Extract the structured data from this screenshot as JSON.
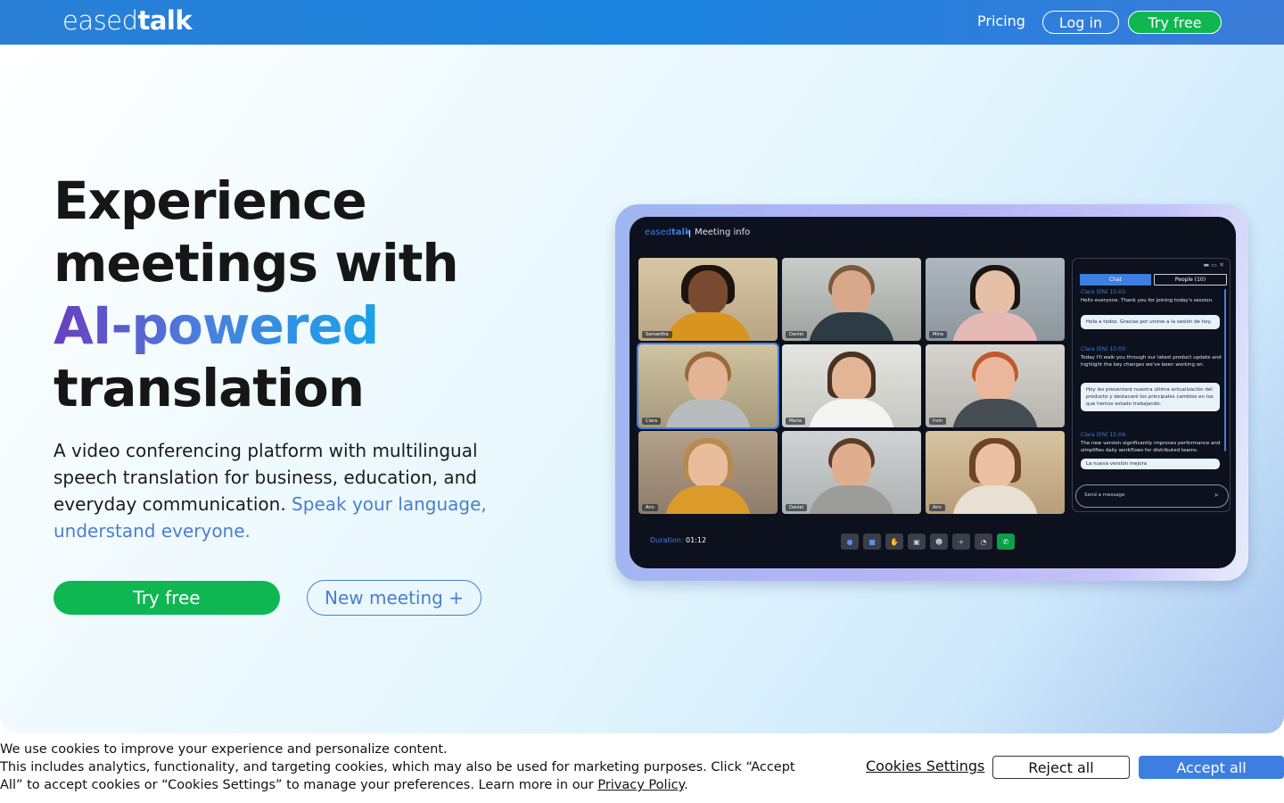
{
  "header": {
    "logo_part1": "eased",
    "logo_part2": "talk",
    "nav_pricing": "Pricing",
    "nav_login": "Log in",
    "nav_try": "Try free"
  },
  "hero": {
    "headline_line1": "Experience",
    "headline_line2": "meetings with",
    "headline_accent": "AI-powered",
    "headline_line4": "translation",
    "subtext": "A video conferencing platform with multilingual speech translation for business, education, and everyday communication.",
    "subtext_highlight": "Speak your language, understand everyone.",
    "btn_try": "Try free",
    "btn_new_meeting": "New meeting +"
  },
  "mockup": {
    "logo_part1": "eased",
    "logo_part2": "talk",
    "title": "Meeting info",
    "participants": [
      "Samantha",
      "Daniel",
      "Mina",
      "Clara",
      "Maria",
      "Irvin",
      "Ann",
      "Daniel",
      "Ann"
    ],
    "chat": {
      "window_controls": "▬ ▭ ✕",
      "tab_chat": "Chat",
      "tab_people": "People (10)",
      "messages": [
        {
          "header": "Clara (EN) 15:03:",
          "text": "Hello everyone. Thank you for joining today's session.",
          "translation": "Hola a todos. Gracias por unirse a la sesión de hoy."
        },
        {
          "header": "Clara (EN) 15:03:",
          "text": "Today I'll walk you through our latest product update and highlight the key changes we've been working on.",
          "translation": "Hoy les presentaré nuestra última actualización del producto y destacaré los principales cambios en los que hemos estado trabajando."
        },
        {
          "header": "Clara (EN) 15:04:",
          "text": "The new version significantly improves performance and simplifies daily workflows for distributed teams.",
          "translation": "La nueva versión mejora"
        }
      ],
      "input_placeholder": "Send a message"
    },
    "duration_label": "Duration:",
    "duration_value": "01:12"
  },
  "cookie": {
    "line1": "We use cookies to improve your experience and personalize content.",
    "line2": "This includes analytics, functionality, and targeting cookies, which may also be used for marketing purposes. Click “Accept All” to accept cookies or “Cookies Settings” to manage your preferences. Learn more in our",
    "privacy_link": "Privacy Policy",
    "settings": "Cookies Settings",
    "reject": "Reject all",
    "accept": "Accept all"
  },
  "colors": {
    "brand_blue": "#3d7fe0",
    "brand_green": "#0fb752",
    "header_blue": "#1a84e0"
  }
}
